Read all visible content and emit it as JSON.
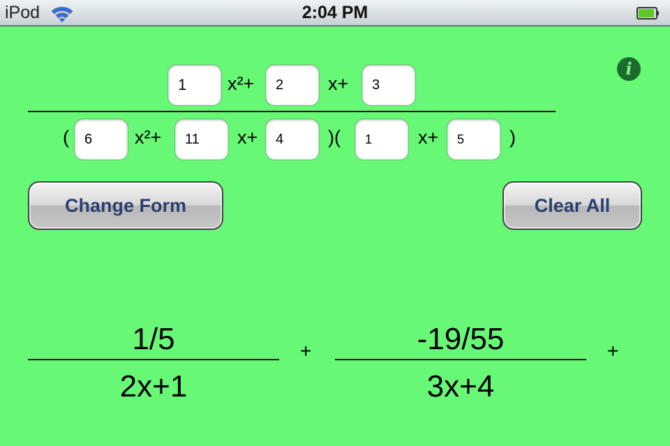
{
  "status_bar": {
    "carrier": "iPod",
    "wifi_icon": "wifi-icon",
    "time": "2:04 PM",
    "battery_icon": "battery-icon",
    "battery_level": 0.85
  },
  "numerator": {
    "a": "1",
    "a_label": "x²+",
    "b": "2",
    "b_label": "x+",
    "c": "3"
  },
  "denominator": {
    "open_paren": "(",
    "a": "6",
    "a_label": "x²+",
    "b": "11",
    "b_label": "x+",
    "c": "4",
    "mid_paren": ")(",
    "d": "1",
    "d_label": "x+",
    "e": "5",
    "close_paren": ")"
  },
  "buttons": {
    "change_form": "Change Form",
    "clear_all": "Clear All",
    "info": "i"
  },
  "result": {
    "terms": [
      {
        "numerator": "1/5",
        "denominator": "2x+1",
        "operator": "+"
      },
      {
        "numerator": "-19/55",
        "denominator": "3x+4",
        "operator": "+"
      }
    ]
  },
  "colors": {
    "background": "#67f876",
    "button_text": "#2a3f6f",
    "info_button": "#1e6b2e"
  }
}
